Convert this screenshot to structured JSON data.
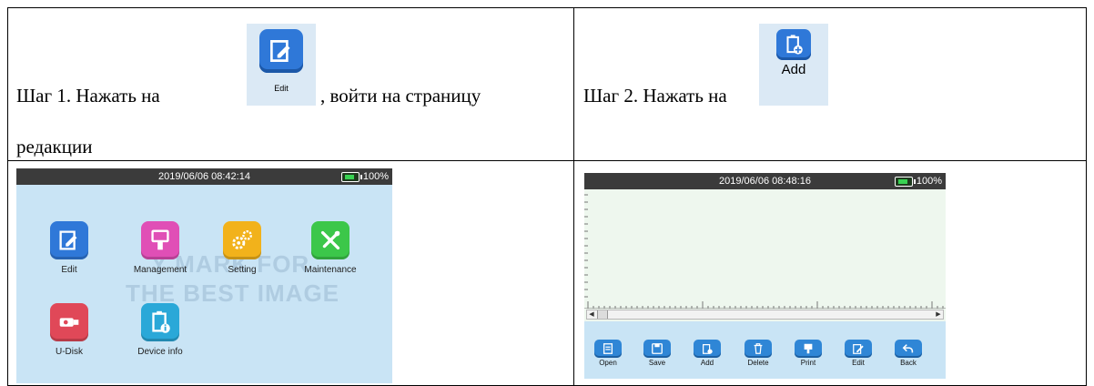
{
  "step1": {
    "text_part1": "Шаг 1. Нажать на",
    "text_part2": ", войти на страницу",
    "text_line2": "редакции",
    "icon_caption": "Edit"
  },
  "step2": {
    "text": "Шаг 2. Нажать на",
    "icon_caption": "Add"
  },
  "screen1": {
    "datetime": "2019/06/06 08:42:14",
    "battery": "100%",
    "apps": [
      {
        "label": "Edit",
        "icon": "edit-icon",
        "color": "#2f78d8"
      },
      {
        "label": "Management",
        "icon": "printer-head-icon",
        "color": "#e04fb6"
      },
      {
        "label": "Setting",
        "icon": "gears-icon",
        "color": "#f2b21b"
      },
      {
        "label": "Maintenance",
        "icon": "tools-icon",
        "color": "#3cc74a"
      },
      {
        "label": "U-Disk",
        "icon": "usb-icon",
        "color": "#e04858"
      },
      {
        "label": "Device info",
        "icon": "info-icon",
        "color": "#2aa8d8"
      }
    ],
    "watermark_line1": "Y MARK FOR",
    "watermark_line2": "THE BEST IMAGE"
  },
  "screen2": {
    "datetime": "2019/06/06 08:48:16",
    "battery": "100%",
    "toolbar": [
      {
        "label": "Open",
        "icon": "open-icon"
      },
      {
        "label": "Save",
        "icon": "save-icon"
      },
      {
        "label": "Add",
        "icon": "add-icon"
      },
      {
        "label": "Delete",
        "icon": "delete-icon"
      },
      {
        "label": "Print",
        "icon": "print-icon"
      },
      {
        "label": "Edit",
        "icon": "edit-icon"
      },
      {
        "label": "Back",
        "icon": "back-icon"
      }
    ]
  },
  "colors": {
    "screen_bg": "#c9e4f5",
    "canvas_bg": "#eef7ee",
    "statusbar_bg": "#3b3b3b",
    "toolbar_blue": "#2f86d6"
  }
}
